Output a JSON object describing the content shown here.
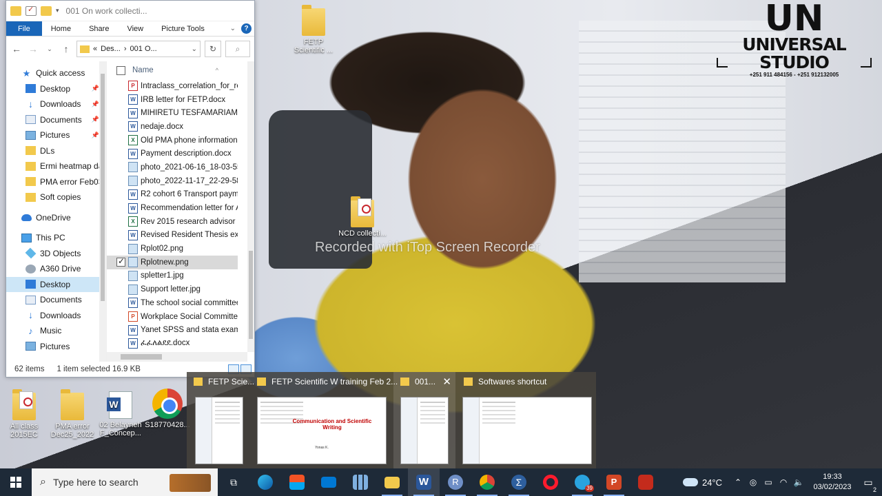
{
  "watermark": "Recorded with iTop Screen Recorder",
  "logo": {
    "mark": "UN",
    "name": "UNIVERSAL STUDIO",
    "phone": "+251 911 484156 - +251 912132005"
  },
  "desktop_icons": [
    {
      "label": "FETP Scientific ...",
      "kind": "folder"
    },
    {
      "label": "NCD collecti...",
      "kind": "folder-pdf"
    },
    {
      "label": "All class 2015EC",
      "kind": "folder-pdf"
    },
    {
      "label": "PMA error Dec25_2022",
      "kind": "folder"
    },
    {
      "label": "02 Belayneh F_Concep...",
      "kind": "word"
    },
    {
      "label": "S18770428...",
      "kind": "chrome"
    }
  ],
  "explorer": {
    "title": "001 On work collecti...",
    "ribbon_tabs": [
      "File",
      "Home",
      "Share",
      "View",
      "Picture Tools"
    ],
    "address": {
      "prefix": "«",
      "crumb1": "Des...",
      "sep": "›",
      "crumb2": "001 O..."
    },
    "nav": {
      "quick_access": "Quick access",
      "quick_items": [
        "Desktop",
        "Downloads",
        "Documents",
        "Pictures",
        "DLs",
        "Ermi heatmap da",
        "PMA error Feb03",
        "Soft copies"
      ],
      "onedrive": "OneDrive",
      "this_pc": "This PC",
      "pc_items": [
        "3D Objects",
        "A360 Drive",
        "Desktop",
        "Documents",
        "Downloads",
        "Music",
        "Pictures"
      ]
    },
    "column_name": "Name",
    "files": [
      {
        "name": "Intraclass_correlation_for_relia",
        "type": "pdf"
      },
      {
        "name": "IRB letter for FETP.docx",
        "type": "word"
      },
      {
        "name": "MIHIRETU TESFAMARIAM eva",
        "type": "word"
      },
      {
        "name": "nedaje.docx",
        "type": "word"
      },
      {
        "name": "Old PMA phone information.x",
        "type": "excel"
      },
      {
        "name": "Payment description.docx",
        "type": "word"
      },
      {
        "name": "photo_2021-06-16_18-03-55.jp",
        "type": "image"
      },
      {
        "name": "photo_2022-11-17_22-29-58.jp",
        "type": "image"
      },
      {
        "name": "R2 cohort 6 Transport paymen",
        "type": "word"
      },
      {
        "name": "Recommendation letter for Ar",
        "type": "word"
      },
      {
        "name": "Rev 2015 research advisor allo",
        "type": "excel"
      },
      {
        "name": "Revised Resident Thesis exami",
        "type": "word"
      },
      {
        "name": "Rplot02.png",
        "type": "image"
      },
      {
        "name": "Rplotnew.png",
        "type": "image",
        "selected": true
      },
      {
        "name": "spletter1.jpg",
        "type": "image"
      },
      {
        "name": "Support letter.jpg",
        "type": "image"
      },
      {
        "name": "The school social committee s",
        "type": "word"
      },
      {
        "name": "Workplace Social Committee",
        "type": "ppt"
      },
      {
        "name": "Yanet SPSS and stata  exam fo",
        "type": "word"
      },
      {
        "name": "ፈፈለልደደ.docx",
        "type": "word"
      }
    ],
    "status": {
      "count": "62 items",
      "selection": "1 item selected  16.9 KB"
    }
  },
  "preview_windows": [
    {
      "label": "FETP Scie..."
    },
    {
      "label": "FETP Scientific W training Feb 2...",
      "doc_title": "Communication and Scientific Writing",
      "doc_sub": "Yonas K."
    },
    {
      "label": "001...",
      "close": "✕"
    },
    {
      "label": "Softwares shortcut"
    }
  ],
  "taskbar": {
    "search_placeholder": "Type here to search",
    "weather_temp": "24°C",
    "time": "19:33",
    "date": "03/02/2023",
    "telegram_badge": "39",
    "notification_count": "2"
  }
}
